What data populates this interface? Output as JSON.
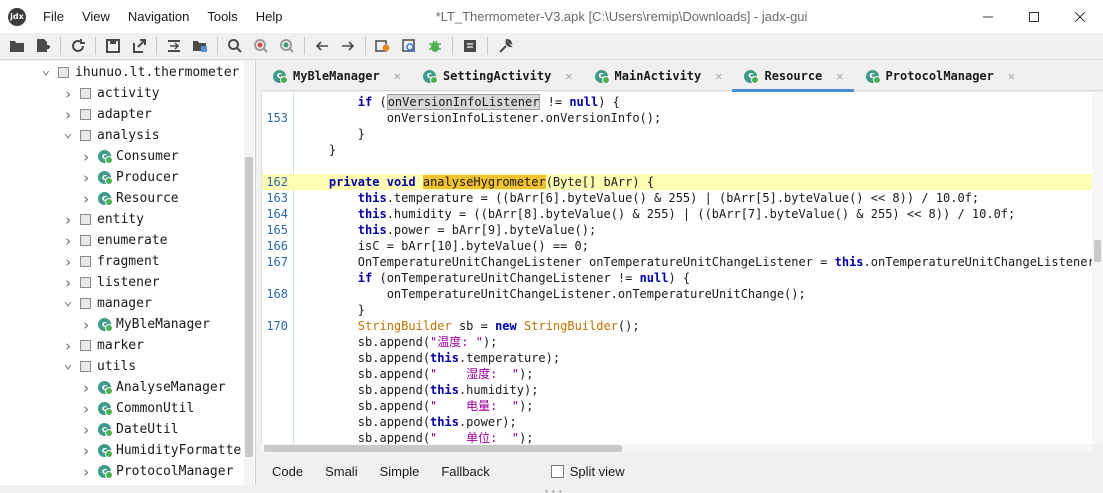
{
  "window": {
    "title": "*LT_Thermometer-V3.apk [C:\\Users\\remip\\Downloads] - jadx-gui",
    "logo_text": "jdx",
    "controls": [
      "minimize",
      "maximize",
      "close"
    ]
  },
  "menu": [
    "File",
    "View",
    "Navigation",
    "Tools",
    "Help"
  ],
  "toolbar": {
    "icons": [
      "open-file-icon",
      "add-files-icon",
      "reload-icon",
      "save-icon",
      "export-icon",
      "sync-tree-icon",
      "flatten-packages-icon",
      "search-icon",
      "search-class-icon",
      "search-usage-icon",
      "back-icon",
      "forward-icon",
      "deobfuscation-icon",
      "quark-icon",
      "debugger-icon",
      "log-icon",
      "preferences-icon"
    ]
  },
  "tree": {
    "root": "ihunuo.lt.thermometer",
    "items": [
      {
        "label": "ihunuo.lt.thermometer",
        "type": "package",
        "level": 0,
        "expanded": true
      },
      {
        "label": "activity",
        "type": "package",
        "level": 1,
        "expanded": false
      },
      {
        "label": "adapter",
        "type": "package",
        "level": 1,
        "expanded": false
      },
      {
        "label": "analysis",
        "type": "package",
        "level": 1,
        "expanded": true
      },
      {
        "label": "Consumer",
        "type": "class",
        "level": 2,
        "expanded": false
      },
      {
        "label": "Producer",
        "type": "class",
        "level": 2,
        "expanded": false
      },
      {
        "label": "Resource",
        "type": "class",
        "level": 2,
        "expanded": false
      },
      {
        "label": "entity",
        "type": "package",
        "level": 1,
        "expanded": false
      },
      {
        "label": "enumerate",
        "type": "package",
        "level": 1,
        "expanded": false
      },
      {
        "label": "fragment",
        "type": "package",
        "level": 1,
        "expanded": false
      },
      {
        "label": "listener",
        "type": "package",
        "level": 1,
        "expanded": false
      },
      {
        "label": "manager",
        "type": "package",
        "level": 1,
        "expanded": true
      },
      {
        "label": "MyBleManager",
        "type": "class",
        "level": 2,
        "expanded": false
      },
      {
        "label": "marker",
        "type": "package",
        "level": 1,
        "expanded": false
      },
      {
        "label": "utils",
        "type": "package",
        "level": 1,
        "expanded": true
      },
      {
        "label": "AnalyseManager",
        "type": "class",
        "level": 2,
        "expanded": false
      },
      {
        "label": "CommonUtil",
        "type": "class",
        "level": 2,
        "expanded": false
      },
      {
        "label": "DateUtil",
        "type": "class",
        "level": 2,
        "expanded": false
      },
      {
        "label": "HumidityFormatte",
        "type": "class",
        "level": 2,
        "expanded": false
      },
      {
        "label": "ProtocolManager",
        "type": "class",
        "level": 2,
        "expanded": false
      }
    ]
  },
  "tabs": [
    {
      "label": "MyBleManager",
      "active": false
    },
    {
      "label": "SettingActivity",
      "active": false
    },
    {
      "label": "MainActivity",
      "active": false
    },
    {
      "label": "Resource",
      "active": true
    },
    {
      "label": "ProtocolManager",
      "active": false
    }
  ],
  "code": {
    "highlighted_line": 162,
    "lines": [
      {
        "ln": "",
        "text": "        if (onVersionInfoListener != null) {"
      },
      {
        "ln": "153",
        "text": "            onVersionInfoListener.onVersionInfo();"
      },
      {
        "ln": "",
        "text": "        }"
      },
      {
        "ln": "",
        "text": "    }"
      },
      {
        "ln": "",
        "text": ""
      },
      {
        "ln": "162",
        "text": "    private void analyseHygrometer(Byte[] bArr) {"
      },
      {
        "ln": "163",
        "text": "        this.temperature = ((bArr[6].byteValue() & 255) | (bArr[5].byteValue() << 8)) / 10.0f;"
      },
      {
        "ln": "164",
        "text": "        this.humidity = ((bArr[8].byteValue() & 255) | ((bArr[7].byteValue() & 255) << 8)) / 10.0f;"
      },
      {
        "ln": "165",
        "text": "        this.power = bArr[9].byteValue();"
      },
      {
        "ln": "166",
        "text": "        isC = bArr[10].byteValue() == 0;"
      },
      {
        "ln": "167",
        "text": "        OnTemperatureUnitChangeListener onTemperatureUnitChangeListener = this.onTemperatureUnitChangeListener;"
      },
      {
        "ln": "",
        "text": "        if (onTemperatureUnitChangeListener != null) {"
      },
      {
        "ln": "168",
        "text": "            onTemperatureUnitChangeListener.onTemperatureUnitChange();"
      },
      {
        "ln": "",
        "text": "        }"
      },
      {
        "ln": "170",
        "text": "        StringBuilder sb = new StringBuilder();"
      },
      {
        "ln": "",
        "text": "        sb.append(\"温度: \");"
      },
      {
        "ln": "",
        "text": "        sb.append(this.temperature);"
      },
      {
        "ln": "",
        "text": "        sb.append(\"    湿度:  \");"
      },
      {
        "ln": "",
        "text": "        sb.append(this.humidity);"
      },
      {
        "ln": "",
        "text": "        sb.append(\"    电量:  \");"
      },
      {
        "ln": "",
        "text": "        sb.append(this.power);"
      },
      {
        "ln": "",
        "text": "        sb.append(\"    单位:  \");"
      }
    ]
  },
  "bottom_tabs": [
    "Code",
    "Smali",
    "Simple",
    "Fallback"
  ],
  "split_view": {
    "label": "Split view",
    "checked": false
  },
  "colors": {
    "keyword": "#0000a8",
    "string": "#a000a0",
    "type": "#c07000",
    "highlight_line": "#fdfdb4",
    "highlight_word": "#f2c12e",
    "line_number": "#2e6aa8",
    "class_icon": "#3f9b8a",
    "active_tab_underline": "#4a90d9"
  }
}
